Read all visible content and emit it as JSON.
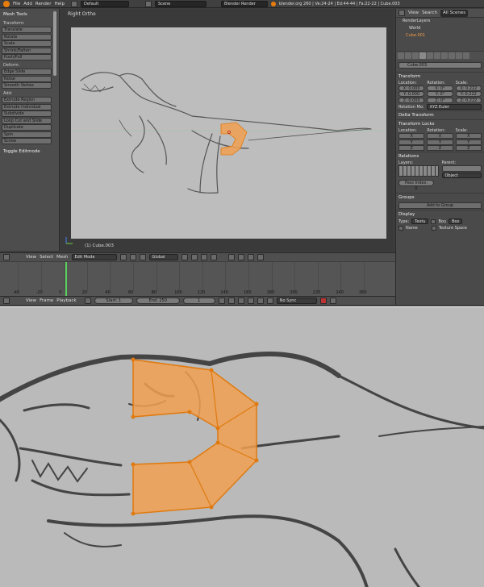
{
  "topbar": {
    "menus": [
      "File",
      "Add",
      "Render",
      "Help"
    ],
    "layout": "Default",
    "scene": "Scene",
    "engine": "Blender Render",
    "stats": "blender.org 260 | Ve:24-24 | Ed:44-44 | Fa:22-22 | Cube.003"
  },
  "toolshelf": {
    "title": "Mesh Tools",
    "sections": [
      {
        "label": "Transform:",
        "buttons": [
          "Translate",
          "Rotate",
          "Scale",
          "Shrink/Fatten",
          "Push/Pull"
        ]
      },
      {
        "label": "Deform:",
        "buttons": [
          "Edge Slide",
          "Noise",
          "Smooth Vertex"
        ]
      },
      {
        "label": "Add:",
        "buttons": [
          "Extrude Region",
          "Extrude Individual",
          "Subdivide",
          "Loop Cut and Slide",
          "Duplicate",
          "Spin",
          "Screw"
        ]
      }
    ],
    "toggle": "Toggle Editmode"
  },
  "viewport": {
    "view_label": "Right Ortho",
    "object_label": "(1) Cube.003"
  },
  "vpheader": {
    "menus": [
      "View",
      "Select",
      "Mesh"
    ],
    "mode": "Edit Mode",
    "orientation": "Global"
  },
  "timeline": {
    "ticks": [
      "-40",
      "-20",
      "0",
      "20",
      "40",
      "60",
      "80",
      "100",
      "120",
      "140",
      "160",
      "180",
      "200",
      "220",
      "240",
      "260"
    ],
    "menus": [
      "View",
      "Frame",
      "Playback"
    ],
    "start": "Start: 1",
    "end": "End: 250",
    "current": "1",
    "sync": "No Sync"
  },
  "outliner": {
    "menus": [
      "View",
      "Search"
    ],
    "filter": "All Scenes",
    "items": [
      "RenderLayers",
      "World",
      "Cube.001"
    ]
  },
  "properties": {
    "object_name": "Cube.003",
    "transform": {
      "title": "Transform",
      "location_label": "Location:",
      "rotation_label": "Rotation:",
      "scale_label": "Scale:",
      "location": [
        "X: 0.000",
        "Y: 0.000",
        "Z: 0.000"
      ],
      "rotation": [
        "X: 0°",
        "Y: 0°",
        "Z: 0°"
      ],
      "scale": [
        "X: 0.222",
        "Y: 0.222",
        "Z: 0.222"
      ],
      "mode_label": "Rotation Mo:",
      "mode": "XYZ Euler"
    },
    "delta_title": "Delta Transform",
    "locks": {
      "title": "Transform Locks",
      "labels": [
        "Location:",
        "Rotation:",
        "Scale:"
      ],
      "axes": [
        "X",
        "Y",
        "Z"
      ]
    },
    "relations": {
      "title": "Relations",
      "layers_label": "Layers:",
      "parent_label": "Parent:",
      "parent_type": "Object",
      "pass_index": "Pass Index: 0"
    },
    "groups": {
      "title": "Groups",
      "add": "Add to Group"
    },
    "display": {
      "title": "Display",
      "type_label": "Type:",
      "type_value": "Textu",
      "bounds": "Bou",
      "bounds_type": "Box",
      "name": "Name",
      "texture_space": "Texture Space"
    }
  },
  "colors": {
    "selection": "#f0a050",
    "selection_edge": "#e07a10",
    "ui_bg": "#4a4a4a",
    "canvas": "#bdbdbd",
    "timeline_cursor": "#58d05b"
  }
}
